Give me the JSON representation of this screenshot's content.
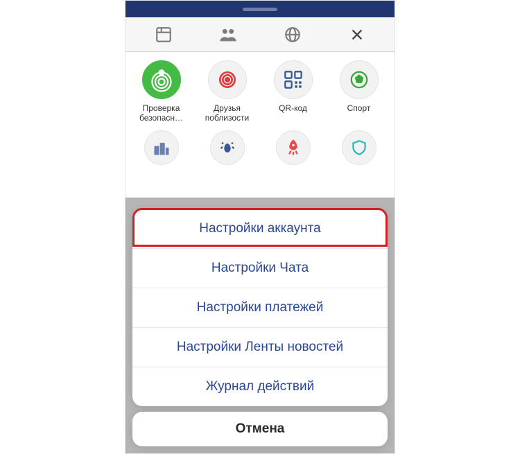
{
  "apps_row1": [
    {
      "name": "safety-check",
      "label": "Проверка безопасн…"
    },
    {
      "name": "nearby-friends",
      "label": "Друзья поблизости"
    },
    {
      "name": "qr-code",
      "label": "QR-код"
    },
    {
      "name": "sports",
      "label": "Спорт"
    }
  ],
  "action_sheet": {
    "items": [
      "Настройки аккаунта",
      "Настройки Чата",
      "Настройки платежей",
      "Настройки Ленты новостей",
      "Журнал действий"
    ],
    "cancel": "Отмена"
  }
}
